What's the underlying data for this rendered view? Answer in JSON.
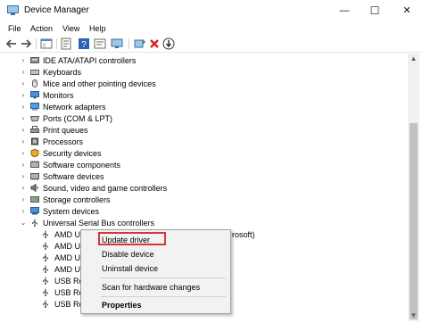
{
  "window": {
    "title": "Device Manager",
    "minimize_glyph": "—",
    "maximize_glyph": "☐",
    "close_glyph": "✕"
  },
  "menu": [
    "File",
    "Action",
    "View",
    "Help"
  ],
  "toolbar": {
    "icons": [
      "back-icon",
      "forward-icon",
      "show-hide-console-tree-icon",
      "properties-icon",
      "help-icon",
      "scan-hardware-icon",
      "update-driver-icon",
      "uninstall-device-icon",
      "disable-device-icon"
    ]
  },
  "tree": {
    "categories": [
      {
        "label": "IDE ATA/ATAPI controllers",
        "icon": "ide-controller-icon"
      },
      {
        "label": "Keyboards",
        "icon": "keyboard-icon"
      },
      {
        "label": "Mice and other pointing devices",
        "icon": "mouse-icon"
      },
      {
        "label": "Monitors",
        "icon": "monitor-icon"
      },
      {
        "label": "Network adapters",
        "icon": "network-adapter-icon"
      },
      {
        "label": "Ports (COM & LPT)",
        "icon": "port-icon"
      },
      {
        "label": "Print queues",
        "icon": "printer-icon"
      },
      {
        "label": "Processors",
        "icon": "processor-icon"
      },
      {
        "label": "Security devices",
        "icon": "security-icon"
      },
      {
        "label": "Software components",
        "icon": "software-component-icon"
      },
      {
        "label": "Software devices",
        "icon": "software-device-icon"
      },
      {
        "label": "Sound, video and game controllers",
        "icon": "sound-icon"
      },
      {
        "label": "Storage controllers",
        "icon": "storage-icon"
      },
      {
        "label": "System devices",
        "icon": "system-device-icon"
      },
      {
        "label": "Universal Serial Bus controllers",
        "icon": "usb-controller-icon"
      }
    ],
    "usb_children": [
      {
        "label": "AMD U",
        "suffix": "rosoft)"
      },
      {
        "label": "AMD U",
        "suffix": ""
      },
      {
        "label": "AMD U",
        "suffix": ""
      },
      {
        "label": "AMD U",
        "suffix": ""
      },
      {
        "label": "USB Ro",
        "suffix": ""
      },
      {
        "label": "USB Ro",
        "suffix": ""
      },
      {
        "label": "USB Ro",
        "suffix": ""
      }
    ]
  },
  "context_menu": {
    "update_driver": "Update driver",
    "disable_device": "Disable device",
    "uninstall_device": "Uninstall device",
    "scan_hardware": "Scan for hardware changes",
    "properties": "Properties"
  },
  "colors": {
    "highlight_border": "#d9343a",
    "usb_icon": "#4a4a4a"
  }
}
